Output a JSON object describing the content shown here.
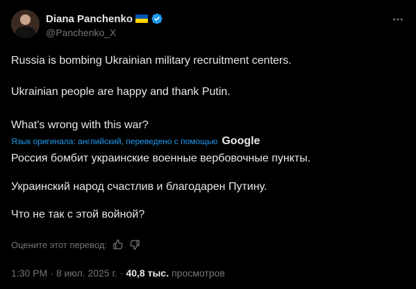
{
  "author": {
    "name": "Diana Panchenko",
    "handle": "@Panchenko_X"
  },
  "original": {
    "p1": "Russia is bombing Ukrainian military recruitment centers.",
    "p2": "Ukrainian people are happy and thank Putin.",
    "p3": "What's wrong with this war?"
  },
  "translation_note": {
    "text": "Язык оригинала: английский, переведено с помощью",
    "provider": "Google"
  },
  "translated": {
    "p1": "Россия бомбит украинские военные вербовочные пункты.",
    "p2": "Украинский народ счастлив и благодарен Путину.",
    "p3": "Что не так с этой войной?"
  },
  "rate_label": "Оцените этот перевод:",
  "meta": {
    "time": "1:30 PM",
    "sep1": "·",
    "date": "8 июл. 2025 г.",
    "sep2": "·",
    "views_count": "40,8 тыс.",
    "views_label": "просмотров"
  },
  "colors": {
    "background": "#000000",
    "text": "#e7e9ea",
    "muted": "#71767b",
    "link": "#1d9bf0",
    "verified": "#1d9bf0"
  },
  "icons": [
    "flag-ukraine-icon",
    "verified-badge-icon",
    "more-icon",
    "thumbs-up-icon",
    "thumbs-down-icon"
  ]
}
